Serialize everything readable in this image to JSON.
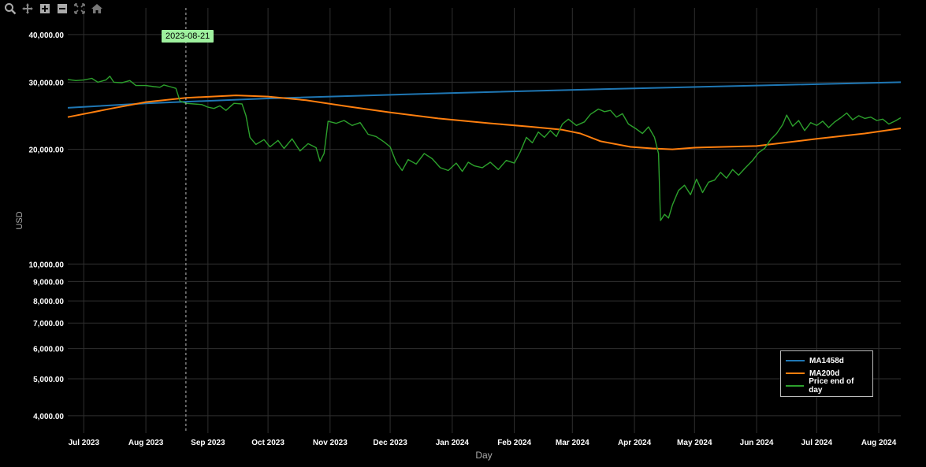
{
  "toolbar": {
    "icons": [
      "zoom-icon",
      "pan-icon",
      "zoom-in-icon",
      "zoom-out-icon",
      "autoscale-icon",
      "home-icon"
    ]
  },
  "hover": {
    "date_label": "2023-08-21",
    "x": "2023-08-21"
  },
  "colors": {
    "background": "#000000",
    "grid": "#2f2f2f",
    "ma1458": "#1f77b4",
    "ma200": "#ff7f0e",
    "price": "#2ca02c"
  },
  "chart_data": {
    "type": "line",
    "xlabel": "Day",
    "ylabel": "USD",
    "y_scale": "log",
    "xlim": [
      "2023-06-23",
      "2024-08-12"
    ],
    "ylim": [
      3600,
      47000
    ],
    "x_ticks": [
      {
        "date": "2023-07-01",
        "label": "Jul 2023"
      },
      {
        "date": "2023-08-01",
        "label": "Aug 2023"
      },
      {
        "date": "2023-09-01",
        "label": "Sep 2023"
      },
      {
        "date": "2023-10-01",
        "label": "Oct 2023"
      },
      {
        "date": "2023-11-01",
        "label": "Nov 2023"
      },
      {
        "date": "2023-12-01",
        "label": "Dec 2023"
      },
      {
        "date": "2024-01-01",
        "label": "Jan 2024"
      },
      {
        "date": "2024-02-01",
        "label": "Feb 2024"
      },
      {
        "date": "2024-03-01",
        "label": "Mar 2024"
      },
      {
        "date": "2024-04-01",
        "label": "Apr 2024"
      },
      {
        "date": "2024-05-01",
        "label": "May 2024"
      },
      {
        "date": "2024-06-01",
        "label": "Jun 2024"
      },
      {
        "date": "2024-07-01",
        "label": "Jul 2024"
      },
      {
        "date": "2024-08-01",
        "label": "Aug 2024"
      }
    ],
    "y_ticks": [
      {
        "value": 4000,
        "label": "4,000.00"
      },
      {
        "value": 5000,
        "label": "5,000.00"
      },
      {
        "value": 6000,
        "label": "6,000.00"
      },
      {
        "value": 7000,
        "label": "7,000.00"
      },
      {
        "value": 8000,
        "label": "8,000.00"
      },
      {
        "value": 9000,
        "label": "9,000.00"
      },
      {
        "value": 10000,
        "label": "10,000.00"
      },
      {
        "value": 20000,
        "label": "20,000.00"
      },
      {
        "value": 30000,
        "label": "30,000.00"
      },
      {
        "value": 40000,
        "label": "40,000.00"
      }
    ],
    "grid": true,
    "legend_position": "bottom-right",
    "series": [
      {
        "name": "MA1458d",
        "color": "#1f77b4",
        "points": [
          [
            "2023-06-23",
            25700
          ],
          [
            "2023-08-01",
            26400
          ],
          [
            "2023-10-01",
            27200
          ],
          [
            "2024-01-01",
            28100
          ],
          [
            "2024-04-01",
            28900
          ],
          [
            "2024-06-01",
            29400
          ],
          [
            "2024-08-12",
            30000
          ]
        ]
      },
      {
        "name": "MA200d",
        "color": "#ff7f0e",
        "points": [
          [
            "2023-06-23",
            24300
          ],
          [
            "2023-07-15",
            25600
          ],
          [
            "2023-08-01",
            26600
          ],
          [
            "2023-08-21",
            27300
          ],
          [
            "2023-09-15",
            27700
          ],
          [
            "2023-10-01",
            27500
          ],
          [
            "2023-10-20",
            26900
          ],
          [
            "2023-11-10",
            25900
          ],
          [
            "2023-12-01",
            25000
          ],
          [
            "2023-12-25",
            24100
          ],
          [
            "2024-01-20",
            23400
          ],
          [
            "2024-02-10",
            22900
          ],
          [
            "2024-02-25",
            22500
          ],
          [
            "2024-03-05",
            22000
          ],
          [
            "2024-03-15",
            21000
          ],
          [
            "2024-03-30",
            20300
          ],
          [
            "2024-04-10",
            20100
          ],
          [
            "2024-04-20",
            20000
          ],
          [
            "2024-05-01",
            20200
          ],
          [
            "2024-06-01",
            20400
          ],
          [
            "2024-07-01",
            21300
          ],
          [
            "2024-07-25",
            22000
          ],
          [
            "2024-08-12",
            22700
          ]
        ]
      },
      {
        "name": "Price end of day",
        "color": "#2ca02c",
        "points": [
          [
            "2023-06-23",
            30500
          ],
          [
            "2023-06-27",
            30300
          ],
          [
            "2023-07-01",
            30400
          ],
          [
            "2023-07-05",
            30700
          ],
          [
            "2023-07-08",
            30000
          ],
          [
            "2023-07-12",
            30400
          ],
          [
            "2023-07-14",
            31100
          ],
          [
            "2023-07-16",
            30000
          ],
          [
            "2023-07-20",
            29900
          ],
          [
            "2023-07-24",
            30300
          ],
          [
            "2023-07-27",
            29400
          ],
          [
            "2023-08-01",
            29400
          ],
          [
            "2023-08-05",
            29200
          ],
          [
            "2023-08-08",
            29100
          ],
          [
            "2023-08-10",
            29500
          ],
          [
            "2023-08-13",
            29200
          ],
          [
            "2023-08-16",
            28900
          ],
          [
            "2023-08-18",
            26800
          ],
          [
            "2023-08-21",
            26400
          ],
          [
            "2023-08-25",
            26300
          ],
          [
            "2023-08-29",
            26200
          ],
          [
            "2023-09-01",
            25800
          ],
          [
            "2023-09-04",
            25600
          ],
          [
            "2023-09-07",
            26000
          ],
          [
            "2023-09-10",
            25300
          ],
          [
            "2023-09-14",
            26400
          ],
          [
            "2023-09-18",
            26300
          ],
          [
            "2023-09-20",
            24500
          ],
          [
            "2023-09-22",
            21500
          ],
          [
            "2023-09-25",
            20600
          ],
          [
            "2023-09-29",
            21200
          ],
          [
            "2023-10-02",
            20300
          ],
          [
            "2023-10-06",
            21100
          ],
          [
            "2023-10-09",
            20100
          ],
          [
            "2023-10-13",
            21300
          ],
          [
            "2023-10-17",
            19800
          ],
          [
            "2023-10-21",
            20700
          ],
          [
            "2023-10-25",
            20200
          ],
          [
            "2023-10-27",
            18600
          ],
          [
            "2023-10-29",
            19500
          ],
          [
            "2023-10-31",
            23700
          ],
          [
            "2023-11-04",
            23400
          ],
          [
            "2023-11-08",
            23800
          ],
          [
            "2023-11-12",
            23100
          ],
          [
            "2023-11-16",
            23500
          ],
          [
            "2023-11-20",
            21900
          ],
          [
            "2023-11-24",
            21600
          ],
          [
            "2023-11-28",
            20900
          ],
          [
            "2023-12-01",
            20300
          ],
          [
            "2023-12-04",
            18500
          ],
          [
            "2023-12-07",
            17600
          ],
          [
            "2023-12-10",
            18800
          ],
          [
            "2023-12-14",
            18300
          ],
          [
            "2023-12-18",
            19500
          ],
          [
            "2023-12-22",
            18900
          ],
          [
            "2023-12-26",
            17900
          ],
          [
            "2023-12-30",
            17600
          ],
          [
            "2024-01-03",
            18400
          ],
          [
            "2024-01-06",
            17500
          ],
          [
            "2024-01-09",
            18500
          ],
          [
            "2024-01-12",
            18100
          ],
          [
            "2024-01-16",
            17900
          ],
          [
            "2024-01-20",
            18500
          ],
          [
            "2024-01-24",
            17700
          ],
          [
            "2024-01-28",
            18700
          ],
          [
            "2024-02-01",
            18400
          ],
          [
            "2024-02-04",
            19700
          ],
          [
            "2024-02-07",
            21500
          ],
          [
            "2024-02-10",
            20800
          ],
          [
            "2024-02-13",
            22200
          ],
          [
            "2024-02-16",
            21500
          ],
          [
            "2024-02-19",
            22400
          ],
          [
            "2024-02-22",
            21600
          ],
          [
            "2024-02-25",
            23300
          ],
          [
            "2024-02-28",
            24000
          ],
          [
            "2024-03-03",
            23100
          ],
          [
            "2024-03-07",
            23600
          ],
          [
            "2024-03-10",
            24700
          ],
          [
            "2024-03-14",
            25500
          ],
          [
            "2024-03-17",
            25100
          ],
          [
            "2024-03-20",
            25300
          ],
          [
            "2024-03-23",
            24300
          ],
          [
            "2024-03-26",
            24800
          ],
          [
            "2024-03-29",
            23300
          ],
          [
            "2024-04-02",
            22600
          ],
          [
            "2024-04-05",
            22000
          ],
          [
            "2024-04-08",
            22900
          ],
          [
            "2024-04-11",
            21500
          ],
          [
            "2024-04-13",
            19500
          ],
          [
            "2024-04-14",
            13000
          ],
          [
            "2024-04-16",
            13500
          ],
          [
            "2024-04-18",
            13200
          ],
          [
            "2024-04-20",
            14300
          ],
          [
            "2024-04-23",
            15600
          ],
          [
            "2024-04-26",
            16100
          ],
          [
            "2024-04-29",
            15200
          ],
          [
            "2024-05-02",
            16700
          ],
          [
            "2024-05-05",
            15400
          ],
          [
            "2024-05-08",
            16400
          ],
          [
            "2024-05-11",
            16600
          ],
          [
            "2024-05-14",
            17400
          ],
          [
            "2024-05-17",
            16800
          ],
          [
            "2024-05-20",
            17700
          ],
          [
            "2024-05-23",
            17100
          ],
          [
            "2024-05-26",
            17800
          ],
          [
            "2024-05-30",
            18700
          ],
          [
            "2024-06-02",
            19600
          ],
          [
            "2024-06-05",
            20100
          ],
          [
            "2024-06-08",
            21200
          ],
          [
            "2024-06-11",
            22000
          ],
          [
            "2024-06-14",
            23200
          ],
          [
            "2024-06-16",
            24600
          ],
          [
            "2024-06-19",
            23000
          ],
          [
            "2024-06-22",
            23800
          ],
          [
            "2024-06-25",
            22400
          ],
          [
            "2024-06-28",
            23500
          ],
          [
            "2024-07-01",
            23100
          ],
          [
            "2024-07-04",
            23700
          ],
          [
            "2024-07-07",
            22800
          ],
          [
            "2024-07-10",
            23600
          ],
          [
            "2024-07-13",
            24200
          ],
          [
            "2024-07-16",
            24900
          ],
          [
            "2024-07-19",
            23900
          ],
          [
            "2024-07-22",
            24500
          ],
          [
            "2024-07-25",
            24100
          ],
          [
            "2024-07-28",
            24300
          ],
          [
            "2024-07-31",
            23800
          ],
          [
            "2024-08-03",
            24000
          ],
          [
            "2024-08-06",
            23300
          ],
          [
            "2024-08-09",
            23700
          ],
          [
            "2024-08-12",
            24200
          ]
        ]
      }
    ]
  }
}
